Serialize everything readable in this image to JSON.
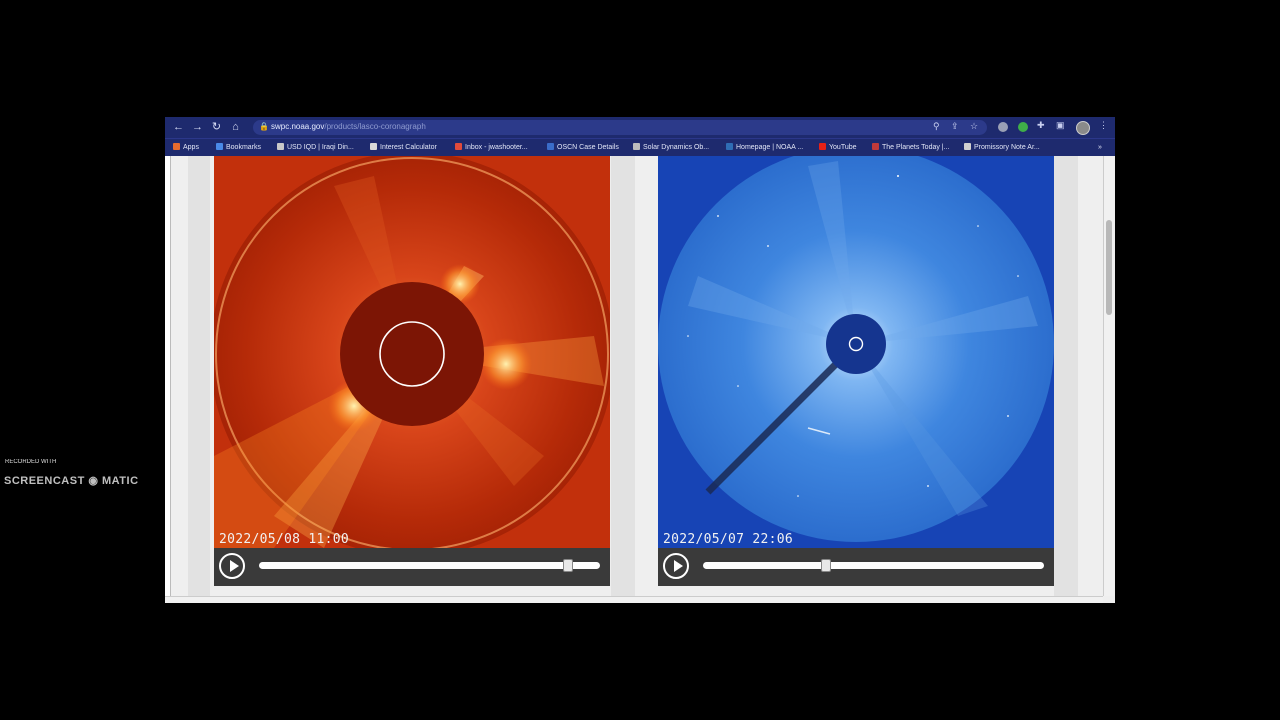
{
  "browser": {
    "url_host": "swpc.noaa.gov",
    "url_path": "/products/lasco-coronagraph",
    "nav": {
      "back": "←",
      "forward": "→",
      "reload": "↻",
      "home": "⌂"
    },
    "icons": [
      "lock-icon",
      "zoom-icon",
      "share-icon",
      "star-icon",
      "extension-icon",
      "puzzle-icon",
      "sidepanel-icon",
      "profile-avatar",
      "menu-icon"
    ]
  },
  "bookmarks": [
    {
      "label": "Apps",
      "icon_color": "#e66b2e"
    },
    {
      "label": "Bookmarks",
      "icon_color": "#4a8ae8"
    },
    {
      "label": "USD IQD | Iraqi Din...",
      "icon_color": "#c9c9c9"
    },
    {
      "label": "Interest Calculator",
      "icon_color": "#d9d9d9"
    },
    {
      "label": "Inbox - jwashooter...",
      "icon_color": "#e24b3b"
    },
    {
      "label": "OSCN Case Details",
      "icon_color": "#3a6cc9"
    },
    {
      "label": "Solar Dynamics Ob...",
      "icon_color": "#bdbdbd"
    },
    {
      "label": "Homepage | NOAA ...",
      "icon_color": "#2f6db5"
    },
    {
      "label": "YouTube",
      "icon_color": "#e62117"
    },
    {
      "label": "The Planets Today |...",
      "icon_color": "#c23a3a"
    },
    {
      "label": "Promissory Note Ar...",
      "icon_color": "#d0d0d0"
    }
  ],
  "bookmarks_overflow": "»",
  "panels": [
    {
      "timestamp": "2022/05/08 11:00",
      "slider_position": 0.905,
      "theme": "red"
    },
    {
      "timestamp": "2022/05/07 22:06",
      "slider_position": 0.36,
      "theme": "blue"
    }
  ],
  "watermark": {
    "small": "RECORDED WITH",
    "brand": "SCREENCAST",
    "brand2": "MATIC"
  },
  "colors": {
    "chrome": "#1e2a6e",
    "red_corona": "#c9340f",
    "blue_corona": "#2f73d8"
  }
}
